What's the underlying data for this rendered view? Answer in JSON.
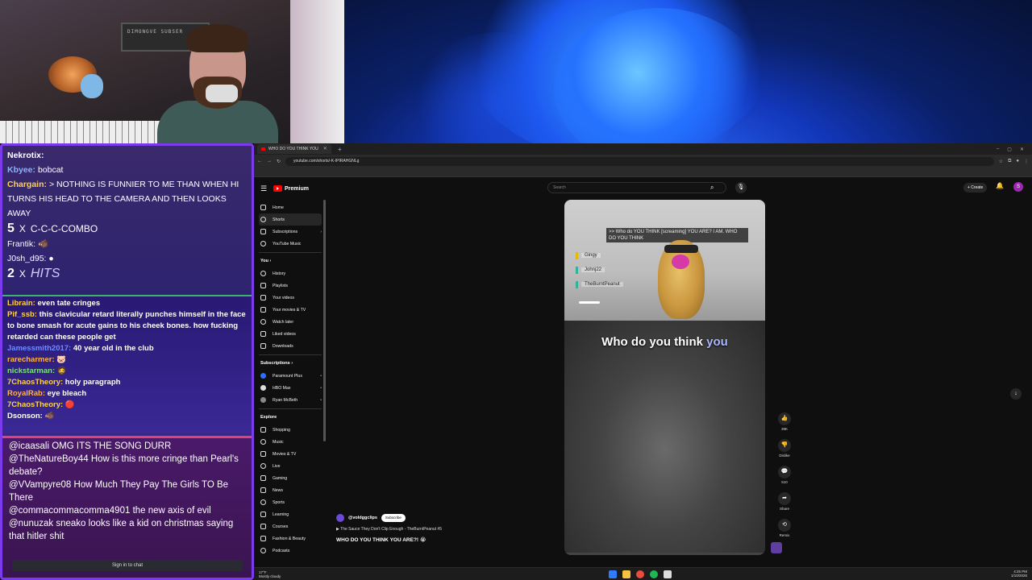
{
  "chat": {
    "top": [
      {
        "user": "Nekrotix:",
        "text": "",
        "color": "#ffffff"
      },
      {
        "user": "Kbyee:",
        "text": "bobcat",
        "color": "#8ab4ff"
      },
      {
        "user": "Chargain:",
        "text": "> NOTHING IS FUNNIER TO ME THAN WHEN HI TURNS HIS HEAD TO THE CAMERA AND THEN LOOKS AWAY",
        "color": "#ffd24a"
      },
      {
        "user": "Frantik:",
        "text": "",
        "color": "#ffffff"
      },
      {
        "user": "J0sh_d95:",
        "text": "",
        "color": "#ffffff"
      }
    ],
    "combo1": {
      "count": "5",
      "times": "X",
      "text": "C-C-C-COMBO"
    },
    "combo2": {
      "count": "2",
      "times": "X",
      "text": "HITS"
    },
    "mid": [
      {
        "user": "Librain:",
        "text": "even tate cringes",
        "color": "#ffd24a"
      },
      {
        "user": "Pif_ssb:",
        "text": "this clavicular retard literally punches himself in the face to bone smash for acute gains to his cheek bones. how fucking retarded can these people get",
        "color": "#ffd24a"
      },
      {
        "user": "Jamessmith2017:",
        "text": "40 year old in the club",
        "color": "#6f8cff"
      },
      {
        "user": "rarecharmer:",
        "text": "",
        "color": "#ffb347"
      },
      {
        "user": "nickstarman:",
        "text": "",
        "color": "#7fe07f"
      },
      {
        "user": "7ChaosTheory:",
        "text": "holy paragraph",
        "color": "#ffd24a"
      },
      {
        "user": "RoyalRab:",
        "text": "eye bleach",
        "color": "#ffb347"
      },
      {
        "user": "7ChaosTheory:",
        "text": "",
        "color": "#ffd24a"
      },
      {
        "user": "Dsonson:",
        "text": "",
        "color": "#ffffff"
      }
    ],
    "bottom": [
      {
        "user": "@icaasali",
        "text": "OMG ITS THE SONG DURR"
      },
      {
        "user": "@TheNatureBoy44",
        "text": "How is this more cringe than Pearl's debate?"
      },
      {
        "user": "@VVampyre08",
        "text": "How Much They Pay The Girls TO Be There"
      },
      {
        "user": "@commacommacomma4901",
        "text": "the new axis of evil"
      },
      {
        "user": "@nunuzak",
        "text": "sneako looks like a kid on christmas saying that hitler shit"
      }
    ],
    "signin": "Sign in to chat"
  },
  "browser": {
    "tab_title": "WHO DO YOU THINK YOU",
    "url": "youtube.com/shorts/-K-IPIRAHGNLg"
  },
  "youtube": {
    "logo": "Premium",
    "search_placeholder": "Search",
    "create": "+ Create",
    "avatar": "S",
    "nav": [
      {
        "label": "Home",
        "icon": "home-icon",
        "active": false
      },
      {
        "label": "Shorts",
        "icon": "shorts-icon",
        "active": true
      },
      {
        "label": "Subscriptions",
        "icon": "subscriptions-icon",
        "active": false
      },
      {
        "label": "YouTube Music",
        "icon": "music-icon",
        "active": false
      }
    ],
    "you_title": "You",
    "you": [
      {
        "label": "History",
        "icon": "history-icon"
      },
      {
        "label": "Playlists",
        "icon": "playlists-icon"
      },
      {
        "label": "Your videos",
        "icon": "your-videos-icon"
      },
      {
        "label": "Your movies & TV",
        "icon": "movies-icon"
      },
      {
        "label": "Watch later",
        "icon": "watch-later-icon"
      },
      {
        "label": "Liked videos",
        "icon": "liked-icon"
      },
      {
        "label": "Downloads",
        "icon": "downloads-icon"
      }
    ],
    "subs_title": "Subscriptions",
    "subs": [
      {
        "label": "Paramount Plus",
        "color": "#2f6fff"
      },
      {
        "label": "HBO Max",
        "color": "#dddddd"
      },
      {
        "label": "Ryan McBeth",
        "color": "#888888"
      }
    ],
    "explore_title": "Explore",
    "explore": [
      {
        "label": "Shopping",
        "icon": "shopping-icon"
      },
      {
        "label": "Music",
        "icon": "music-note-icon"
      },
      {
        "label": "Movies & TV",
        "icon": "film-icon"
      },
      {
        "label": "Live",
        "icon": "live-icon"
      },
      {
        "label": "Gaming",
        "icon": "gaming-icon"
      },
      {
        "label": "News",
        "icon": "news-icon"
      },
      {
        "label": "Sports",
        "icon": "sports-icon"
      },
      {
        "label": "Learning",
        "icon": "learning-icon"
      },
      {
        "label": "Courses",
        "icon": "courses-icon"
      },
      {
        "label": "Fashion & Beauty",
        "icon": "fashion-icon"
      },
      {
        "label": "Podcasts",
        "icon": "podcasts-icon"
      }
    ],
    "short": {
      "caption": ">> Who do YOU THINK [screaming] YOU ARE? I AM. WHO DO YOU THINK",
      "voices": [
        "Gingy",
        "Johnj22",
        "TheBurntPeanut"
      ],
      "subtitle_main": "Who do you think",
      "subtitle_hl": "you",
      "channel": "@voldggclips",
      "subscribe": "Subscribe",
      "playlist": "The Sauce They Don't Clip Enough - TheBurntPeanut #5",
      "title": "WHO DO YOU THINK YOU ARE?! 😭"
    },
    "actions": [
      {
        "icon": "like-icon",
        "glyph": "👍",
        "label": "39K"
      },
      {
        "icon": "dislike-icon",
        "glyph": "👎",
        "label": "Dislike"
      },
      {
        "icon": "comments-icon",
        "glyph": "💬",
        "label": "510"
      },
      {
        "icon": "share-icon",
        "glyph": "➦",
        "label": "Share"
      },
      {
        "icon": "remix-icon",
        "glyph": "⟲",
        "label": "Remix"
      }
    ]
  },
  "taskbar": {
    "weather_temp": "17°F",
    "weather_desc": "Mostly cloudy",
    "time": "4:25 PM",
    "date": "1/10/2026"
  }
}
